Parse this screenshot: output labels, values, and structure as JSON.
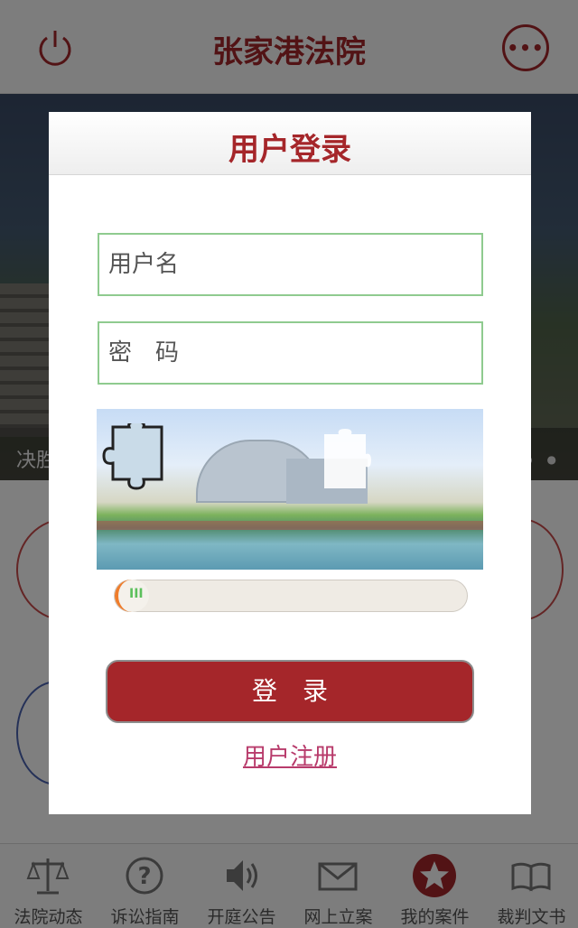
{
  "header": {
    "title": "张家港法院",
    "power_icon": "power-icon",
    "more_icon": "more-icon",
    "more_glyph": "•••"
  },
  "banner": {
    "caption": "决胜"
  },
  "tabs": [
    {
      "label": "法院动态",
      "icon": "scales-icon"
    },
    {
      "label": "诉讼指南",
      "icon": "question-icon"
    },
    {
      "label": "开庭公告",
      "icon": "speaker-icon"
    },
    {
      "label": "网上立案",
      "icon": "mail-icon"
    },
    {
      "label": "我的案件",
      "icon": "star-icon",
      "active": true
    },
    {
      "label": "裁判文书",
      "icon": "book-icon"
    }
  ],
  "login": {
    "title": "用户登录",
    "username_placeholder": "用户名",
    "password_placeholder": "密　码",
    "submit_label": "登　录",
    "register_link": "用户注册"
  },
  "colors": {
    "brand": "#a5262a",
    "input_border": "#8fcb8f",
    "slider_accent": "#ef7d2c",
    "link": "#b83b6b"
  }
}
